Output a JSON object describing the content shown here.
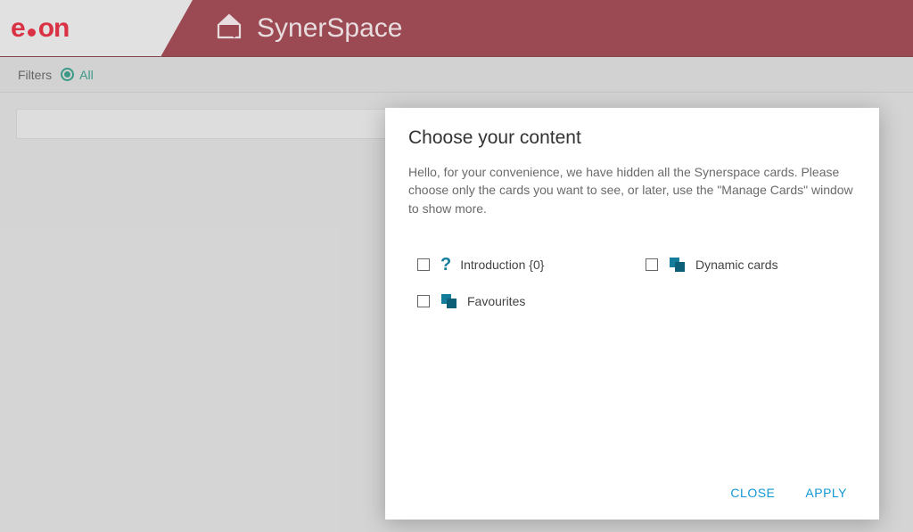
{
  "header": {
    "logo_text_e": "e",
    "logo_text_on": "on",
    "app_title": "SynerSpace"
  },
  "filter_bar": {
    "label": "Filters",
    "selected": "All"
  },
  "modal": {
    "title": "Choose your content",
    "description": "Hello, for your convenience, we have hidden all the Synerspace cards. Please choose only the cards you want to see, or later, use the \"Manage Cards\" window to show more.",
    "options": {
      "introduction": {
        "label": "Introduction {0}",
        "checked": false
      },
      "dynamic_cards": {
        "label": "Dynamic cards",
        "checked": false
      },
      "favourites": {
        "label": "Favourites",
        "checked": false
      }
    },
    "buttons": {
      "close": "CLOSE",
      "apply": "APPLY"
    }
  },
  "colors": {
    "brand_red": "#8d1f2d",
    "eon_red": "#e1001a",
    "accent_teal": "#0e8a72",
    "icon_blue": "#147d9c",
    "action_blue": "#1497d4"
  }
}
